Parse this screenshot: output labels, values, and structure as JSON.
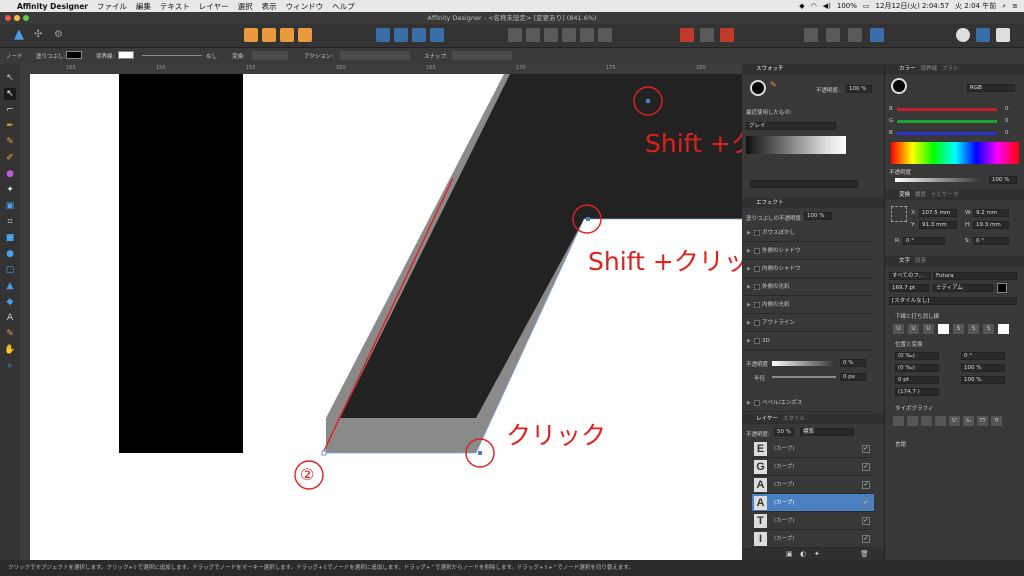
{
  "menubar": {
    "apple": "",
    "app_name": "Affinity Designer",
    "items": [
      "ファイル",
      "編集",
      "テキスト",
      "レイヤー",
      "選択",
      "表示",
      "ウィンドウ",
      "ヘルプ"
    ],
    "clock": "12月12日(火) 2:04:57",
    "clock2": "火 2:04 午前",
    "battery": "100%"
  },
  "window": {
    "title": "Affinity Designer - <名称未設定> [変更あり] (841.6%)"
  },
  "context": {
    "mode": "ノード",
    "fill_label": "塗りつぶし:",
    "stroke_label": "境界線:",
    "stroke_value": "なし",
    "convert_label": "変換:",
    "action_label": "アクション:",
    "snap_label": "スナップ:"
  },
  "ruler": {
    "ticks": [
      "165",
      "150",
      "155",
      "160",
      "165",
      "170",
      "175",
      "180",
      "185"
    ]
  },
  "swatches": {
    "title": "スウォッチ",
    "opacity_label": "不透明度:",
    "opacity_value": "100 %",
    "recent_label": "最近使用したもの:",
    "palette": "グレイ"
  },
  "color": {
    "tab_active": "カラー",
    "tabs": [
      "境界線",
      "ブラシ"
    ],
    "model": "RGB",
    "r_label": "R",
    "r_value": "0",
    "g_label": "G",
    "g_value": "0",
    "b_label": "B",
    "b_value": "0",
    "opacity_label": "不透明度",
    "opacity_value": "100 %"
  },
  "effects": {
    "title": "エフェクト",
    "fill_opacity_label": "塗りつぶしの不透明度:",
    "fill_opacity_value": "100 %",
    "items": [
      "ガウスぼかし",
      "外側のシャドウ",
      "内側のシャドウ",
      "外側の光彩",
      "内側の光彩",
      "アウトライン",
      "3D"
    ],
    "opacity_label": "不透明度",
    "opacity_value": "0 %",
    "radius_label": "半径",
    "radius_value": "0 px",
    "bevel": "ベベル/エンボス"
  },
  "transform": {
    "tab_active": "変換",
    "tabs": [
      "履歴",
      "ナビゲータ"
    ],
    "x": "107.5 mm",
    "y": "91.3 mm",
    "w": "9.2 mm",
    "h": "19.3 mm",
    "r": "0 °",
    "s": "0 °",
    "x_label": "X:",
    "y_label": "Y:",
    "w_label": "W:",
    "h_label": "H:",
    "r_label": "R:",
    "s_label": "S:"
  },
  "text": {
    "tab_active": "文字",
    "tabs": [
      "段落"
    ],
    "font_category": "すべてのフ...",
    "font": "Futura",
    "size": "169.7 pt",
    "weight": "ミディアム",
    "style": "[スタイルなし]",
    "underline_section": "下線と打ち消し線",
    "position_section": "位置と変換",
    "pos_a": "(0 ‰)",
    "pos_b": "0 °",
    "pos_c": "(0 ‰)",
    "pos_d": "100 %",
    "pos_e": "0 pt",
    "pos_f": "100 %",
    "pos_g": "(174.7 )",
    "typography_section": "タイポグラフィ",
    "language_section": "言語",
    "btn_s1": "S",
    "btn_s2": "S",
    "btn_super": "S²",
    "btn_sub": "S₂",
    "btn_tt": "TT",
    "btn_tr": "Tr"
  },
  "layers": {
    "tab_active": "レイヤー",
    "tabs": [
      "スタイル"
    ],
    "opacity_label": "不透明度:",
    "opacity_value": "50 %",
    "blend": "標準",
    "items": [
      {
        "letter": "E",
        "name": "(カーブ)"
      },
      {
        "letter": "G",
        "name": "(カーブ)"
      },
      {
        "letter": "A",
        "name": "(カーブ)"
      },
      {
        "letter": "A",
        "name": "(カーブ)"
      },
      {
        "letter": "T",
        "name": "(カーブ)"
      },
      {
        "letter": "I",
        "name": "(カーブ)"
      }
    ]
  },
  "annotations": {
    "shift_click_1": "Shift +クリック",
    "shift_click_2": "Shift +クリック",
    "click": "クリック",
    "step": "②"
  },
  "status": {
    "text": "クリックでオブジェクトを選択します。クリック+⇧で選択に追加します。ドラッグでノードをマーキー選択します。ドラッグ+⇧でノードを選択に追加します。ドラッグ+⌃で選択からノードを削除します。ドラッグ+⇧+⌃でノード選択を切り替えます。"
  },
  "colors": {
    "accent": "#4a7fc1",
    "annotation": "#e0201e",
    "shape_dark": "#222222",
    "shape_gray": "#8a8a8a"
  }
}
